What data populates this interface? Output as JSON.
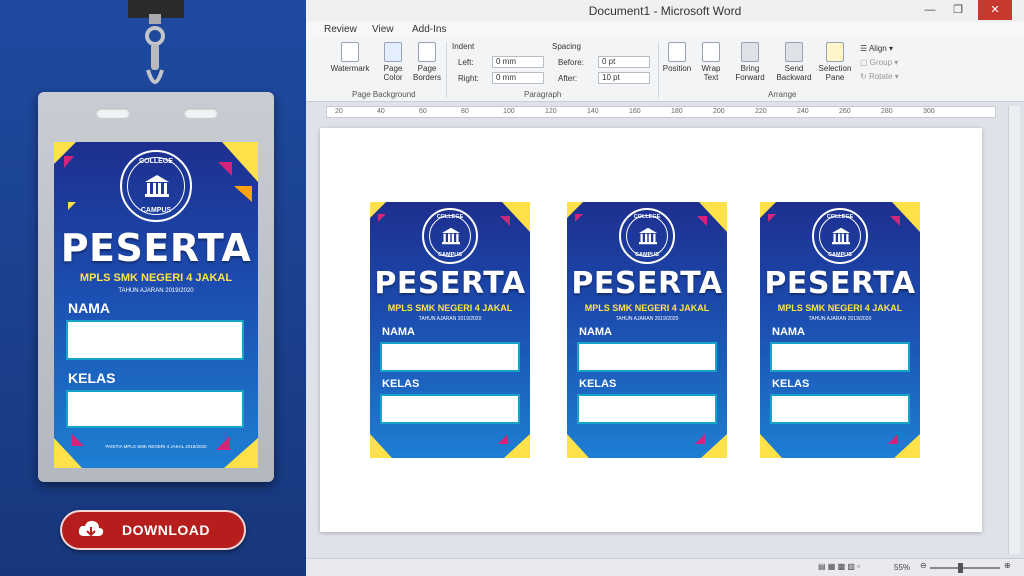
{
  "promo": {
    "download_label": "DOWNLOAD",
    "card": {
      "logo_top": "COLLEGE",
      "logo_bottom": "CAMPUS",
      "title": "PESERTA",
      "subtitle": "MPLS SMK NEGERI 4 JAKAL",
      "year": "TAHUN AJARAN 2019/2020",
      "label_name": "NAMA",
      "label_class": "KELAS",
      "footer": "PANITIA MPLS SMK NEGERI 4 JAKAL 2019/2020"
    }
  },
  "word": {
    "title": "Document1 - Microsoft Word",
    "tabs": [
      "Review",
      "View",
      "Add-Ins"
    ],
    "ribbon": {
      "watermark": "Watermark",
      "page_color": "Page Color",
      "page_borders": "Page Borders",
      "page_background_group": "Page Background",
      "indent_label": "Indent",
      "left_label": "Left:",
      "left_value": "0 mm",
      "right_label": "Right:",
      "right_value": "0 mm",
      "spacing_label": "Spacing",
      "before_label": "Before:",
      "before_value": "0 pt",
      "after_label": "After:",
      "after_value": "10 pt",
      "paragraph_group": "Paragraph",
      "position": "Position",
      "wrap_text": "Wrap Text",
      "bring_forward": "Bring Forward",
      "send_backward": "Send Backward",
      "selection_pane": "Selection Pane",
      "align": "Align",
      "group": "Group",
      "rotate": "Rotate",
      "arrange_group": "Arrange"
    },
    "ruler": [
      "20",
      "40",
      "60",
      "80",
      "100",
      "120",
      "140",
      "160",
      "180",
      "200",
      "220",
      "240",
      "260",
      "280",
      "300"
    ],
    "zoom": "55%",
    "cards": [
      {
        "logo_top": "COLLEGE",
        "logo_bottom": "CAMPUS",
        "title": "PESERTA",
        "subtitle": "MPLS SMK NEGERI 4 JAKAL",
        "year": "TAHUN AJARAN 2019/2020",
        "label_name": "NAMA",
        "label_class": "KELAS"
      },
      {
        "logo_top": "COLLEGE",
        "logo_bottom": "CAMPUS",
        "title": "PESERTA",
        "subtitle": "MPLS SMK NEGERI 4 JAKAL",
        "year": "TAHUN AJARAN 2019/2020",
        "label_name": "NAMA",
        "label_class": "KELAS"
      },
      {
        "logo_top": "COLLEGE",
        "logo_bottom": "CAMPUS",
        "title": "PESERTA",
        "subtitle": "MPLS SMK NEGERI 4 JAKAL",
        "year": "TAHUN AJARAN 2019/2020",
        "label_name": "NAMA",
        "label_class": "KELAS"
      }
    ]
  },
  "colors": {
    "panel_bg": "#1c3f86",
    "card_dark": "#1d2f8f",
    "card_light": "#1d7fd3",
    "accent_yellow": "#ffe24a",
    "accent_magenta": "#d4237a",
    "download_red": "#b61d1d"
  }
}
